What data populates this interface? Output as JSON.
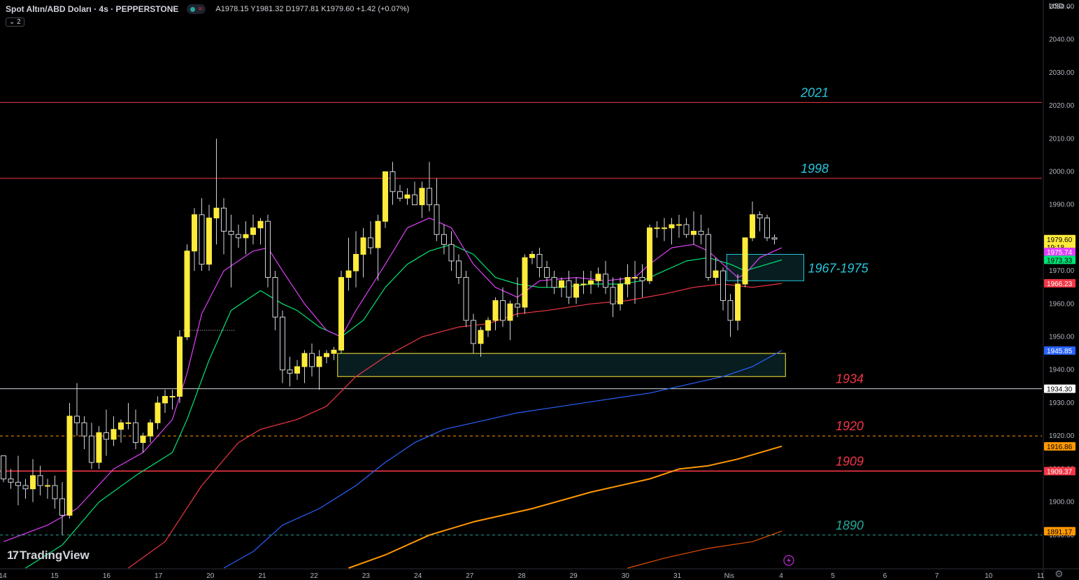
{
  "header": {
    "symbol": "Spot Altın/ABD Doları · 4s · PEPPERSTONE",
    "wave_icon": "≈",
    "ohlc": "A1978.15 Y1981.32 D1977.81 K1979.60 +1.42 (+0.07%)",
    "indicator_count": "⌄ 2",
    "currency": "USD ⌄"
  },
  "branding": {
    "logo": "TradingView"
  },
  "colors": {
    "up": "#ffeb3b",
    "down": "#000000",
    "wick": "#d1d4dc",
    "ema_fast": "#e040fb",
    "ema_mid": "#00e676",
    "ema_slow": "#f23645",
    "ema_100": "#2962ff",
    "ema_200": "#ff9800",
    "ema_300": "#e65100",
    "level_label": "#26c6da",
    "level_label_low": "#f23645",
    "level_label_teal": "#26a69a"
  },
  "chart_data": {
    "type": "candlestick",
    "ylim": [
      1880,
      2052
    ],
    "y_ticks": [
      1890,
      1900,
      1910,
      1920,
      1930,
      1940,
      1950,
      1960,
      1970,
      1980,
      1990,
      2000,
      2010,
      2020,
      2030,
      2040,
      2050
    ],
    "x_ticks": [
      "14",
      "15",
      "16",
      "17",
      "20",
      "21",
      "22",
      "23",
      "24",
      "27",
      "28",
      "29",
      "30",
      "31",
      "Nis",
      "4",
      "5",
      "6",
      "7",
      "10",
      "11"
    ],
    "candles": [
      [
        1914,
        1914,
        1906,
        1907
      ],
      [
        1907,
        1910,
        1904,
        1906
      ],
      [
        1906,
        1914,
        1899,
        1905
      ],
      [
        1905,
        1907,
        1901,
        1904
      ],
      [
        1904,
        1913,
        1900,
        1908
      ],
      [
        1908,
        1911,
        1902,
        1905
      ],
      [
        1905,
        1907,
        1901,
        1905
      ],
      [
        1905,
        1908,
        1898,
        1901
      ],
      [
        1901,
        1906,
        1890,
        1896
      ],
      [
        1896,
        1930,
        1895,
        1926
      ],
      [
        1926,
        1936,
        1920,
        1924
      ],
      [
        1924,
        1926,
        1916,
        1920
      ],
      [
        1920,
        1924,
        1910,
        1912
      ],
      [
        1912,
        1923,
        1910,
        1921
      ],
      [
        1921,
        1928,
        1914,
        1919
      ],
      [
        1919,
        1926,
        1917,
        1922
      ],
      [
        1922,
        1925,
        1918,
        1924
      ],
      [
        1924,
        1930,
        1922,
        1924
      ],
      [
        1924,
        1928,
        1916,
        1918
      ],
      [
        1918,
        1921,
        1915,
        1920
      ],
      [
        1920,
        1925,
        1918,
        1924
      ],
      [
        1924,
        1932,
        1922,
        1930
      ],
      [
        1930,
        1934,
        1927,
        1932
      ],
      [
        1932,
        1934,
        1928,
        1932
      ],
      [
        1932,
        1952,
        1930,
        1950
      ],
      [
        1950,
        1978,
        1949,
        1976
      ],
      [
        1976,
        1989,
        1970,
        1987
      ],
      [
        1987,
        1992,
        1970,
        1972
      ],
      [
        1972,
        1990,
        1970,
        1986
      ],
      [
        1986,
        2010,
        1978,
        1989
      ],
      [
        1989,
        1992,
        1975,
        1982
      ],
      [
        1982,
        1987,
        1965,
        1981
      ],
      [
        1981,
        1984,
        1977,
        1980
      ],
      [
        1980,
        1985,
        1975,
        1981
      ],
      [
        1981,
        1987,
        1978,
        1983
      ],
      [
        1983,
        1986,
        1978,
        1985
      ],
      [
        1985,
        1987,
        1965,
        1968
      ],
      [
        1968,
        1970,
        1952,
        1956
      ],
      [
        1956,
        1958,
        1936,
        1940
      ],
      [
        1940,
        1944,
        1935,
        1939
      ],
      [
        1939,
        1943,
        1937,
        1941
      ],
      [
        1941,
        1946,
        1936,
        1945
      ],
      [
        1945,
        1948,
        1938,
        1941
      ],
      [
        1941,
        1946,
        1934,
        1944
      ],
      [
        1944,
        1946,
        1942,
        1945
      ],
      [
        1945,
        1947,
        1943,
        1946
      ],
      [
        1946,
        1970,
        1945,
        1968
      ],
      [
        1968,
        1980,
        1964,
        1970
      ],
      [
        1970,
        1982,
        1965,
        1975
      ],
      [
        1975,
        1983,
        1968,
        1980
      ],
      [
        1980,
        1985,
        1975,
        1977
      ],
      [
        1977,
        1987,
        1967,
        1985
      ],
      [
        1985,
        2000,
        1983,
        2000
      ],
      [
        2000,
        2003,
        1990,
        1994
      ],
      [
        1994,
        1996,
        1991,
        1992
      ],
      [
        1992,
        1995,
        1990,
        1993
      ],
      [
        1993,
        1997,
        1990,
        1990
      ],
      [
        1990,
        1997,
        1986,
        1995
      ],
      [
        1995,
        2003,
        1988,
        1990
      ],
      [
        1990,
        1998,
        1979,
        1981
      ],
      [
        1981,
        1984,
        1975,
        1978
      ],
      [
        1978,
        1982,
        1970,
        1973
      ],
      [
        1973,
        1975,
        1966,
        1968
      ],
      [
        1968,
        1970,
        1953,
        1955
      ],
      [
        1955,
        1957,
        1945,
        1948
      ],
      [
        1948,
        1953,
        1944,
        1952
      ],
      [
        1952,
        1956,
        1950,
        1955
      ],
      [
        1955,
        1962,
        1952,
        1961
      ],
      [
        1961,
        1965,
        1953,
        1955
      ],
      [
        1955,
        1961,
        1949,
        1960
      ],
      [
        1960,
        1968,
        1956,
        1959
      ],
      [
        1959,
        1975,
        1957,
        1974
      ],
      [
        1974,
        1976,
        1972,
        1975
      ],
      [
        1975,
        1977,
        1968,
        1971
      ],
      [
        1971,
        1973,
        1965,
        1968
      ],
      [
        1968,
        1970,
        1963,
        1965
      ],
      [
        1965,
        1968,
        1962,
        1967
      ],
      [
        1967,
        1970,
        1960,
        1962
      ],
      [
        1962,
        1968,
        1960,
        1966
      ],
      [
        1966,
        1970,
        1963,
        1966
      ],
      [
        1966,
        1970,
        1963,
        1967
      ],
      [
        1967,
        1971,
        1965,
        1969
      ],
      [
        1969,
        1973,
        1963,
        1965
      ],
      [
        1965,
        1968,
        1956,
        1960
      ],
      [
        1960,
        1968,
        1958,
        1966
      ],
      [
        1966,
        1972,
        1962,
        1968
      ],
      [
        1968,
        1973,
        1960,
        1968
      ],
      [
        1968,
        1972,
        1962,
        1967
      ],
      [
        1967,
        1984,
        1966,
        1983
      ],
      [
        1983,
        1985,
        1980,
        1983
      ],
      [
        1983,
        1986,
        1979,
        1983
      ],
      [
        1983,
        1986,
        1978,
        1984
      ],
      [
        1984,
        1987,
        1980,
        1984
      ],
      [
        1984,
        1986,
        1980,
        1981
      ],
      [
        1981,
        1988,
        1978,
        1982
      ],
      [
        1982,
        1987,
        1978,
        1981
      ],
      [
        1981,
        1983,
        1967,
        1968
      ],
      [
        1968,
        1974,
        1966,
        1970
      ],
      [
        1970,
        1971,
        1958,
        1961
      ],
      [
        1961,
        1963,
        1950,
        1955
      ],
      [
        1955,
        1969,
        1952,
        1966
      ],
      [
        1966,
        1980,
        1965,
        1980
      ],
      [
        1980,
        1991,
        1979,
        1987
      ],
      [
        1987,
        1988,
        1982,
        1986
      ],
      [
        1986,
        1987,
        1979,
        1980
      ],
      [
        1980,
        1981,
        1978,
        1979.6
      ]
    ],
    "ema_fast": [
      [
        0,
        1888
      ],
      [
        6,
        1893
      ],
      [
        10,
        1898
      ],
      [
        15,
        1910
      ],
      [
        19,
        1915
      ],
      [
        23,
        1925
      ],
      [
        25,
        1939
      ],
      [
        27,
        1957
      ],
      [
        30,
        1970
      ],
      [
        34,
        1976
      ],
      [
        36,
        1977
      ],
      [
        38,
        1970
      ],
      [
        41,
        1960
      ],
      [
        44,
        1952
      ],
      [
        46,
        1950
      ],
      [
        48,
        1958
      ],
      [
        52,
        1972
      ],
      [
        55,
        1983
      ],
      [
        58,
        1986
      ],
      [
        61,
        1983
      ],
      [
        64,
        1972
      ],
      [
        67,
        1965
      ],
      [
        70,
        1962
      ],
      [
        73,
        1967
      ],
      [
        78,
        1968
      ],
      [
        82,
        1967
      ],
      [
        86,
        1968
      ],
      [
        88,
        1972
      ],
      [
        91,
        1977
      ],
      [
        94,
        1978
      ],
      [
        96,
        1976
      ],
      [
        98,
        1972
      ],
      [
        100,
        1968
      ],
      [
        101,
        1969
      ],
      [
        103,
        1974
      ],
      [
        106,
        1977
      ]
    ],
    "ema_mid": [
      [
        3,
        1880
      ],
      [
        8,
        1887
      ],
      [
        13,
        1900
      ],
      [
        18,
        1908
      ],
      [
        23,
        1915
      ],
      [
        25,
        1925
      ],
      [
        28,
        1943
      ],
      [
        31,
        1958
      ],
      [
        35,
        1964
      ],
      [
        38,
        1960
      ],
      [
        40,
        1958
      ],
      [
        43,
        1953
      ],
      [
        46,
        1950
      ],
      [
        49,
        1955
      ],
      [
        52,
        1965
      ],
      [
        55,
        1972
      ],
      [
        58,
        1976
      ],
      [
        61,
        1978
      ],
      [
        64,
        1975
      ],
      [
        67,
        1968
      ],
      [
        70,
        1966
      ],
      [
        73,
        1965
      ],
      [
        76,
        1965
      ],
      [
        80,
        1966
      ],
      [
        84,
        1966
      ],
      [
        87,
        1967
      ],
      [
        90,
        1970
      ],
      [
        93,
        1973
      ],
      [
        96,
        1974
      ],
      [
        99,
        1972
      ],
      [
        101,
        1970
      ],
      [
        104,
        1972
      ],
      [
        106,
        1973.3
      ]
    ],
    "ema_slow": [
      [
        17,
        1880
      ],
      [
        22,
        1888
      ],
      [
        27,
        1905
      ],
      [
        32,
        1918
      ],
      [
        35,
        1922
      ],
      [
        40,
        1925
      ],
      [
        44,
        1929
      ],
      [
        48,
        1938
      ],
      [
        52,
        1944
      ],
      [
        57,
        1950
      ],
      [
        62,
        1953
      ],
      [
        66,
        1954
      ],
      [
        70,
        1957
      ],
      [
        74,
        1958
      ],
      [
        80,
        1960
      ],
      [
        85,
        1961
      ],
      [
        90,
        1963
      ],
      [
        94,
        1965
      ],
      [
        98,
        1966
      ],
      [
        102,
        1965
      ],
      [
        106,
        1966.2
      ]
    ],
    "ema_100": [
      [
        30,
        1880
      ],
      [
        34,
        1885
      ],
      [
        38,
        1893
      ],
      [
        43,
        1898
      ],
      [
        48,
        1905
      ],
      [
        52,
        1912
      ],
      [
        56,
        1918
      ],
      [
        60,
        1922
      ],
      [
        64,
        1924
      ],
      [
        70,
        1927
      ],
      [
        76,
        1929
      ],
      [
        82,
        1931
      ],
      [
        88,
        1933
      ],
      [
        94,
        1936
      ],
      [
        98,
        1938
      ],
      [
        102,
        1941
      ],
      [
        106,
        1945.9
      ]
    ],
    "ema_200": [
      [
        47,
        1880
      ],
      [
        52,
        1884
      ],
      [
        58,
        1890
      ],
      [
        64,
        1894
      ],
      [
        72,
        1898
      ],
      [
        80,
        1903
      ],
      [
        88,
        1907
      ],
      [
        92,
        1910
      ],
      [
        96,
        1911
      ],
      [
        100,
        1913
      ],
      [
        106,
        1916.9
      ]
    ],
    "ema_300": [
      [
        85,
        1880
      ],
      [
        90,
        1883
      ],
      [
        96,
        1886
      ],
      [
        102,
        1888
      ],
      [
        106,
        1891.2
      ]
    ],
    "levels": [
      {
        "price": 2021,
        "style": "solid",
        "color": "#f23645",
        "label": "2021",
        "label_color": "#26c6da"
      },
      {
        "price": 1998,
        "style": "solid",
        "color": "#f23645",
        "label": "1998",
        "label_color": "#26c6da"
      },
      {
        "price": 1934.3,
        "style": "solid",
        "color": "#d1d4dc",
        "label": "1934",
        "label_color": "#f23645"
      },
      {
        "price": 1920,
        "style": "dashed",
        "color": "#ff9800",
        "label": "1920",
        "label_color": "#f23645"
      },
      {
        "price": 1909.37,
        "style": "solid",
        "color": "#f23645",
        "label": "1909",
        "label_color": "#f23645"
      },
      {
        "price": 1890,
        "style": "dashed",
        "color": "#26a69a",
        "label": "1890",
        "label_color": "#26a69a"
      }
    ],
    "zones": [
      {
        "x0": 45.5,
        "x1": 106.5,
        "y0": 1938,
        "y1": 1945,
        "color": "#ffeb3b"
      },
      {
        "x0": 98.5,
        "x1": 109,
        "y0": 1967,
        "y1": 1975,
        "color": "#26c6da",
        "label": "1967-1975"
      }
    ],
    "price_tags": [
      {
        "price": 1979.6,
        "text": "1979.60",
        "sub": "19:18",
        "bg": "#ffeb3b",
        "fg": "#000000"
      },
      {
        "price": 1975.74,
        "text": "1975.74",
        "bg": "#e040fb",
        "fg": "#ffffff"
      },
      {
        "price": 1973.33,
        "text": "1973.33",
        "bg": "#00e676",
        "fg": "#000000"
      },
      {
        "price": 1966.23,
        "text": "1966.23",
        "bg": "#f23645",
        "fg": "#ffffff"
      },
      {
        "price": 1945.85,
        "text": "1945.85",
        "bg": "#2962ff",
        "fg": "#ffffff"
      },
      {
        "price": 1934.3,
        "text": "1934.30",
        "bg": "#ffffff",
        "fg": "#000000"
      },
      {
        "price": 1916.86,
        "text": "1916.86",
        "bg": "#ff9800",
        "fg": "#000000"
      },
      {
        "price": 1909.37,
        "text": "1909.37",
        "bg": "#f23645",
        "fg": "#ffffff"
      },
      {
        "price": 1891.17,
        "text": "1891.17",
        "bg": "#ff9800",
        "fg": "#000000"
      }
    ]
  }
}
